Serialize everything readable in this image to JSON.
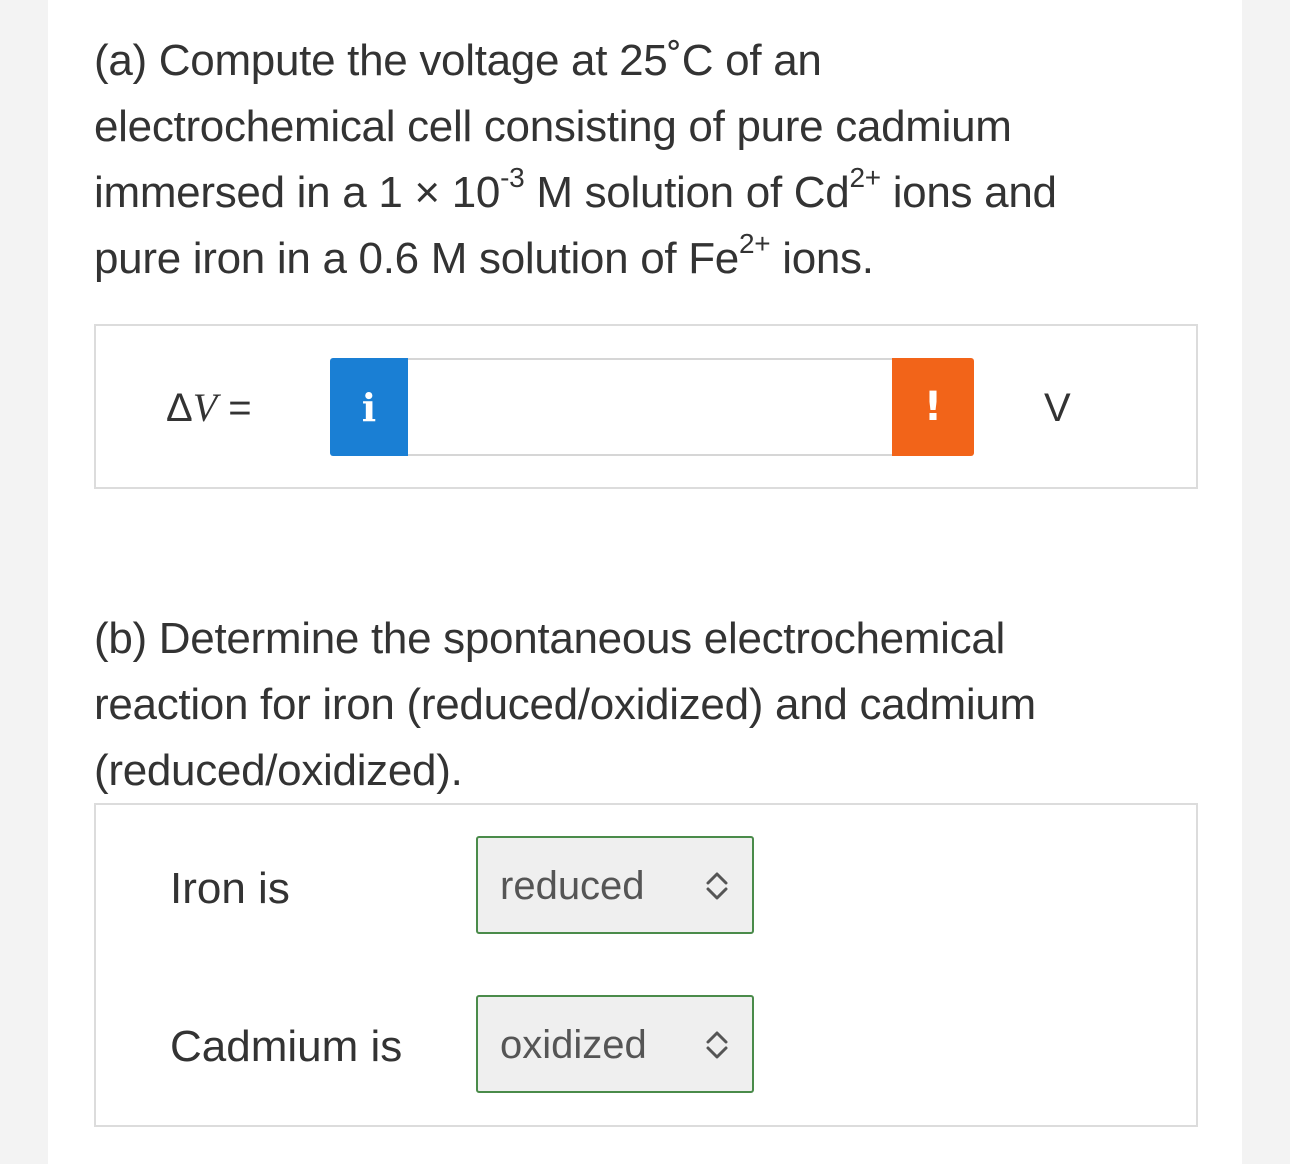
{
  "part_a": {
    "line1": "(a) Compute the voltage at 25˚C of an",
    "line2": "electrochemical cell consisting of pure cadmium",
    "line3_pre": "immersed in a 1 × 10",
    "line3_exp": "-3",
    "line3_mid": " M solution of Cd",
    "line3_charge": "2+",
    "line3_post": " ions and",
    "line4_pre": "pure iron in a 0.6 M solution of Fe",
    "line4_charge": "2+",
    "line4_post": " ions.",
    "answer": {
      "label_delta": "Δ",
      "label_var": "V",
      "label_eq": " =",
      "info_icon_text": "i",
      "input_value": "",
      "warn_icon_text": "!",
      "unit": "V"
    }
  },
  "part_b": {
    "line1": "(b) Determine the spontaneous electrochemical",
    "line2": "reaction for iron (reduced/oxidized) and cadmium",
    "line3": "(reduced/oxidized).",
    "rows": [
      {
        "label": "Iron is",
        "selected": "reduced"
      },
      {
        "label": "Cadmium is",
        "selected": "oxidized"
      }
    ]
  },
  "colors": {
    "info_button": "#1a7fd4",
    "warning_button": "#f26419",
    "select_border": "#4a8b4a"
  }
}
